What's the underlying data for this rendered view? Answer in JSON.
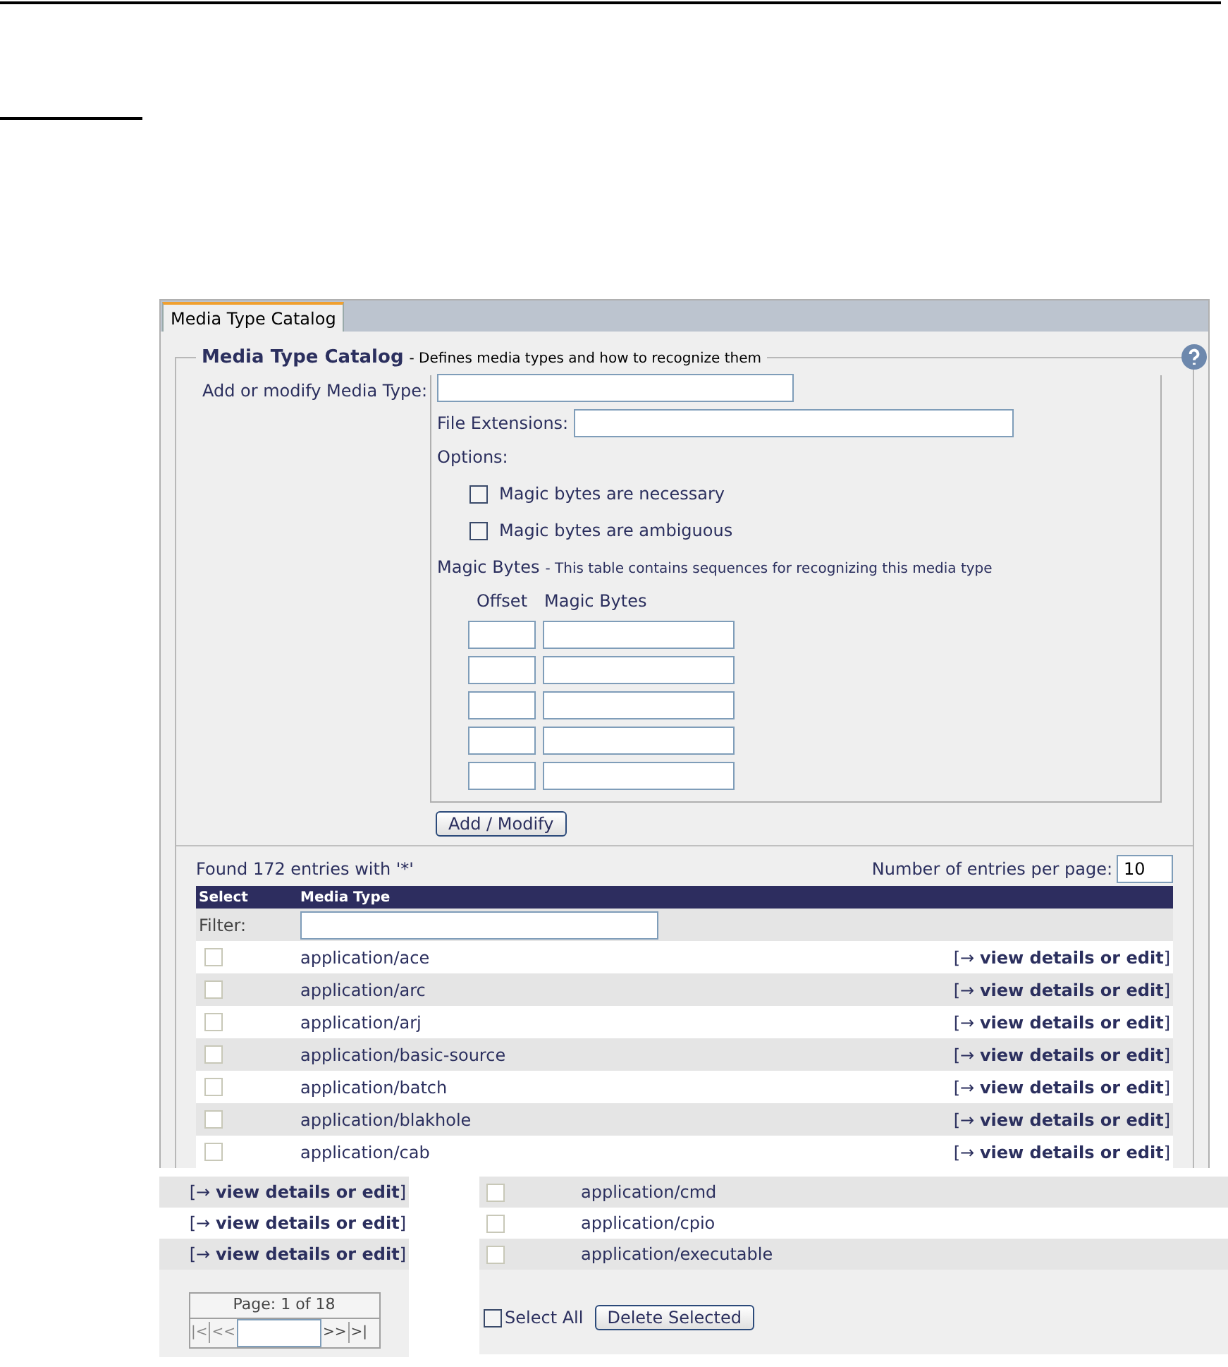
{
  "tab": {
    "label": "Media Type Catalog",
    "selected": true
  },
  "fieldset": {
    "title": "Media Type Catalog",
    "subtitle": "- Defines media types and how to recognize them"
  },
  "form": {
    "media_type_label": "Add or modify Media Type:",
    "extensions_label": "File Extensions:",
    "options_label": "Options:",
    "options": [
      {
        "label": "Magic bytes are necessary",
        "checked": false
      },
      {
        "label": "Magic bytes are ambiguous",
        "checked": false
      }
    ],
    "magic_title": "Magic Bytes",
    "magic_subtitle": "- This table contains sequences for recognizing this media type",
    "magic_columns": [
      "Offset",
      "Magic Bytes"
    ],
    "submit": "Add / Modify"
  },
  "summary": "Found 172 entries with '*'",
  "per_page_label": "Number of entries per page:",
  "per_page_value": "10",
  "table": {
    "columns": [
      "Select",
      "Media Type"
    ],
    "filter_label": "Filter:",
    "rows": [
      {
        "media_type": "application/ace",
        "link": "[→ **view details or edit**]",
        "checked": false
      },
      {
        "media_type": "application/arc",
        "link": "[→ **view details or edit**]",
        "checked": false
      },
      {
        "media_type": "application/arj",
        "link": "[→ **view details or edit**]",
        "checked": false
      },
      {
        "media_type": "application/basic-source",
        "link": "[→ **view details or edit**]",
        "checked": false
      },
      {
        "media_type": "application/batch",
        "link": "[→ **view details or edit**]",
        "checked": false
      },
      {
        "media_type": "application/blakhole",
        "link": "[→ **view details or edit**]",
        "checked": false
      },
      {
        "media_type": "application/cab",
        "link": "[→ **view details or edit**]",
        "checked": false
      }
    ]
  },
  "lower_left": {
    "links": [
      "[→ **view details or edit**]",
      "[→ **view details or edit**]",
      "[→ **view details or edit**]"
    ],
    "pager": {
      "label": "Page: 1 of 18",
      "first": "|<",
      "prev": "<<",
      "next": ">>",
      "last": ">|"
    }
  },
  "lower_right": {
    "rows": [
      {
        "media_type": "application/cmd",
        "checked": false
      },
      {
        "media_type": "application/cpio",
        "checked": false
      },
      {
        "media_type": "application/executable",
        "checked": false
      }
    ],
    "select_all": {
      "label": "Select All",
      "checked": false
    },
    "delete": "Delete Selected"
  }
}
